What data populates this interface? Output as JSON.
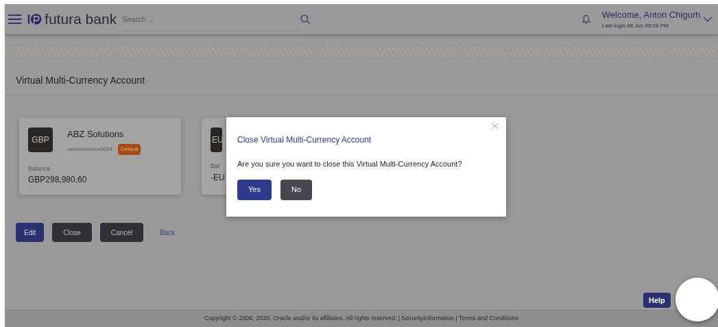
{
  "header": {
    "brand": "futura bank",
    "search": {
      "placeholder": "Search ..."
    },
    "welcome": "Welcome, Anton Chigurh",
    "last_login": "Last login 08 Jun 05:08 PM"
  },
  "page_title": "Virtual Multi-Currency Account",
  "accounts": [
    {
      "currency": "GBP",
      "name": "ABZ Solutions",
      "number": "xxxxxxxxxxxx0024",
      "badge": "Default",
      "balance_label": "Balance",
      "balance": "GBP298,980.60"
    },
    {
      "currency": "EU",
      "balance_label": "Bal",
      "balance": "-EU"
    }
  ],
  "actions": [
    {
      "label": "Edit",
      "kind": "primary"
    },
    {
      "label": "Close",
      "kind": "dark"
    },
    {
      "label": "Cancel",
      "kind": "dark"
    },
    {
      "label": "Back",
      "kind": "link"
    }
  ],
  "dialog": {
    "title": "Close Virtual Multi-Currency Account",
    "message": "Are you sure you want to close this Virtual Multi-Currency Account?",
    "buttons": [
      {
        "label": "Yes",
        "kind": "primary"
      },
      {
        "label": "No",
        "kind": "dark"
      }
    ]
  },
  "help": "Help",
  "footer": {
    "copyright": "Copyright © 2006, 2020, Oracle and/or its affiliates. All rights reserved.",
    "separator": "|",
    "links": [
      "SecurityInformation",
      "Terms and Conditions"
    ]
  }
}
